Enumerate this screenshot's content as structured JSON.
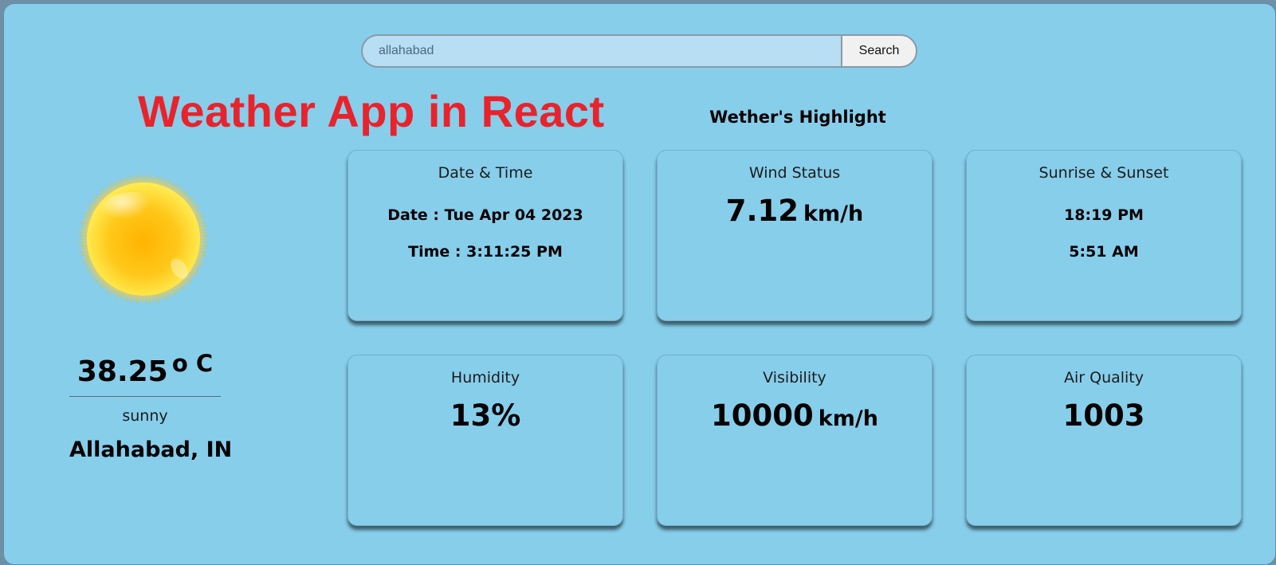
{
  "search": {
    "value": "allahabad",
    "button_label": "Search"
  },
  "header": {
    "app_title": "Weather App in React",
    "highlight_title": "Wether's Highlight"
  },
  "current": {
    "icon": "sun-icon",
    "temperature": "38.25",
    "temperature_unit": "o C",
    "condition": "sunny",
    "location": "Allahabad, IN"
  },
  "cards": {
    "datetime": {
      "title": "Date & Time",
      "date": "Date : Tue Apr 04 2023",
      "time": "Time : 3:11:25 PM"
    },
    "wind": {
      "title": "Wind Status",
      "value": "7.12",
      "unit": "km/h"
    },
    "sun": {
      "title": "Sunrise & Sunset",
      "first": "18:19 PM",
      "second": "5:51 AM"
    },
    "humidity": {
      "title": "Humidity",
      "value": "13%"
    },
    "visibility": {
      "title": "Visibility",
      "value": "10000",
      "unit": "km/h"
    },
    "air_quality": {
      "title": "Air Quality",
      "value": "1003"
    }
  },
  "colors": {
    "background": "#87ceeb",
    "title_red": "#e8232c"
  }
}
